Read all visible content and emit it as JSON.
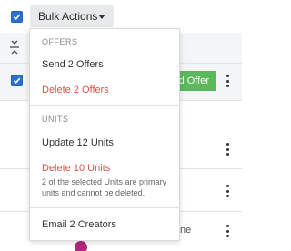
{
  "toolbar": {
    "bulk_actions_label": "Bulk Actions"
  },
  "rows": {
    "offer_button_label": "d Offer",
    "partial_name_text": "ne"
  },
  "dropdown": {
    "offers_header": "OFFERS",
    "send_offers_label": "Send 2 Offers",
    "delete_offers_label": "Delete 2 Offers",
    "units_header": "UNITS",
    "update_units_label": "Update 12 Units",
    "delete_units_label": "Delete 10 Units",
    "delete_units_note": "2 of the selected Units are primary units and cannot be deleted.",
    "email_creators_label": "Email 2 Creators"
  },
  "colors": {
    "checkbox": "#2b6fd3",
    "danger": "#d9534f",
    "offer_button": "#5cb85c",
    "avatar": "#b3267e"
  },
  "icons": {
    "collapse": "collapse-rows-icon",
    "caret": "caret-down-icon",
    "kebab": "kebab-menu-icon",
    "check": "checkmark-icon"
  }
}
